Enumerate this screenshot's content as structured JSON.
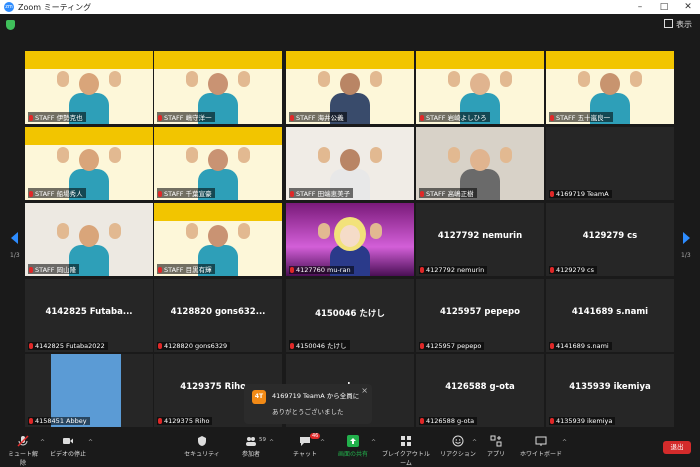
{
  "window": {
    "title": "Zoom ミーティング",
    "logo_text": "zm"
  },
  "topbar": {
    "view_label": "表示"
  },
  "tiles": [
    {
      "name": "STAFF 伊勢克也"
    },
    {
      "name": "STAFF 嶋守洋一"
    },
    {
      "name": "STAFF 海井公義"
    },
    {
      "name": "STAFF 岩崎よしひろ"
    },
    {
      "name": "STAFF 五十嵐良一"
    },
    {
      "name": "STAFF 船場秀人"
    },
    {
      "name": "STAFF 千葉宣豪"
    },
    {
      "name": "STAFF 田端恵美子"
    },
    {
      "name": "STAFF 高嶋正樹"
    },
    {
      "name": "4169719 TeamA"
    },
    {
      "name": "STAFF 岡山隆"
    },
    {
      "name": "STAFF 目黒有輝"
    },
    {
      "name": "4127760 mu-ran"
    },
    {
      "name": "4127792 nemurin",
      "big": "4127792 nemurin"
    },
    {
      "name": "4129279 cs",
      "big": "4129279 cs"
    },
    {
      "name": "4142825 Futaba2022",
      "big": "4142825 Futaba..."
    },
    {
      "name": "4128820 gons6329",
      "big": "4128820 gons632..."
    },
    {
      "name": "4150046 たけし",
      "big": "4150046 たけし"
    },
    {
      "name": "4125957 pepepo",
      "big": "4125957 pepepo"
    },
    {
      "name": "4141689 s.nami",
      "big": "4141689 s.nami"
    },
    {
      "name": "4158451 Abbey"
    },
    {
      "name": "4129375 Riho",
      "big": "4129375 Riho..."
    },
    {
      "name": "",
      "big": "...log"
    },
    {
      "name": "4126588 g-ota",
      "big": "4126588 g-ota"
    },
    {
      "name": "4135939 ikemiya",
      "big": "4135939 ikemiya"
    }
  ],
  "pager": {
    "left": "1/3",
    "right": "1/3"
  },
  "notification": {
    "avatar": "4T",
    "title": "4169719 TeamA から全員に",
    "message": "ありがとうございました"
  },
  "toolbar": {
    "mute": "ミュート解除",
    "video": "ビデオの停止",
    "security": "セキュリティ",
    "participants": "参加者",
    "participants_count": "59",
    "chat": "チャット",
    "chat_badge": "46",
    "share": "画面の共有",
    "breakout": "ブレイクアウトルーム",
    "reactions": "リアクション",
    "apps": "アプリ",
    "whiteboard": "ホワイトボード",
    "leave": "退出"
  },
  "colors": {
    "accent": "#2d8cff",
    "share_green": "#22b14c",
    "leave_red": "#d32b2b",
    "speaker_green": "#3ad13a"
  }
}
